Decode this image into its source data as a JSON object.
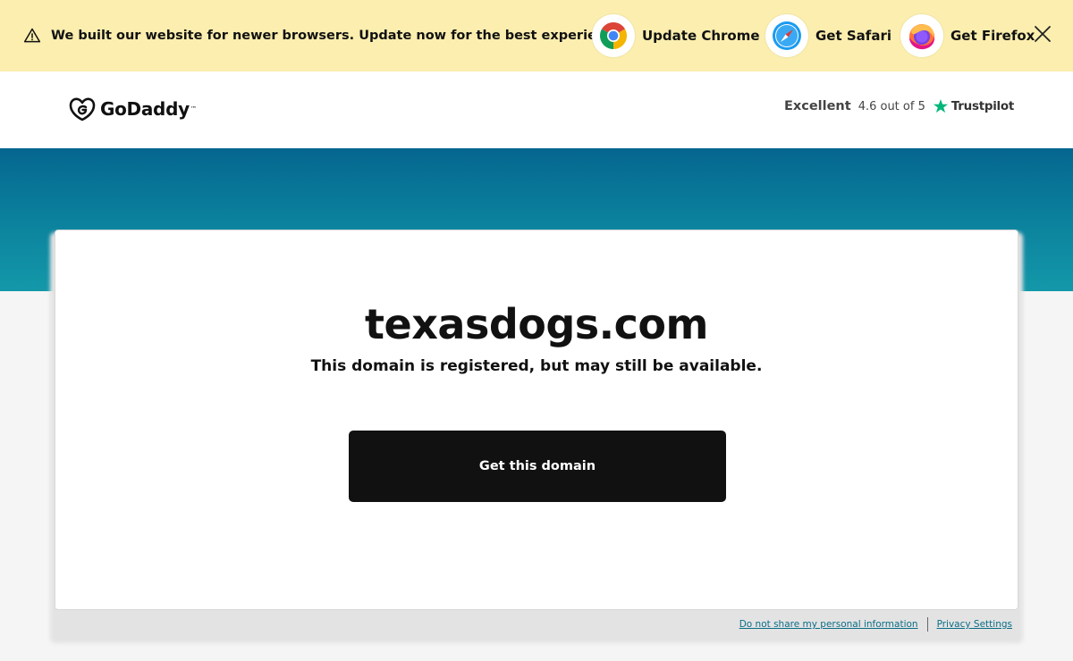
{
  "banner": {
    "message": "We built our website for newer browsers. Update now for the best experience.",
    "browsers": [
      {
        "label": "Update Chrome",
        "icon": "chrome-icon"
      },
      {
        "label": "Get Safari",
        "icon": "safari-icon"
      },
      {
        "label": "Get Firefox",
        "icon": "firefox-icon"
      }
    ]
  },
  "header": {
    "logo_text": "GoDaddy",
    "rating": {
      "word": "Excellent",
      "score": "4.6 out of 5",
      "provider": "Trustpilot"
    }
  },
  "card": {
    "domain": "texasdogs.com",
    "subtitle": "This domain is registered, but may still be available.",
    "cta_label": "Get this domain"
  },
  "footer": {
    "links": [
      "Do not share my personal information",
      "Privacy Settings"
    ]
  },
  "colors": {
    "banner_bg": "#fbeeae",
    "hero_top": "#05668f",
    "hero_bottom": "#1498a9",
    "button_bg": "#111111",
    "link": "#0b6d86",
    "trustpilot_green": "#00b67a"
  }
}
